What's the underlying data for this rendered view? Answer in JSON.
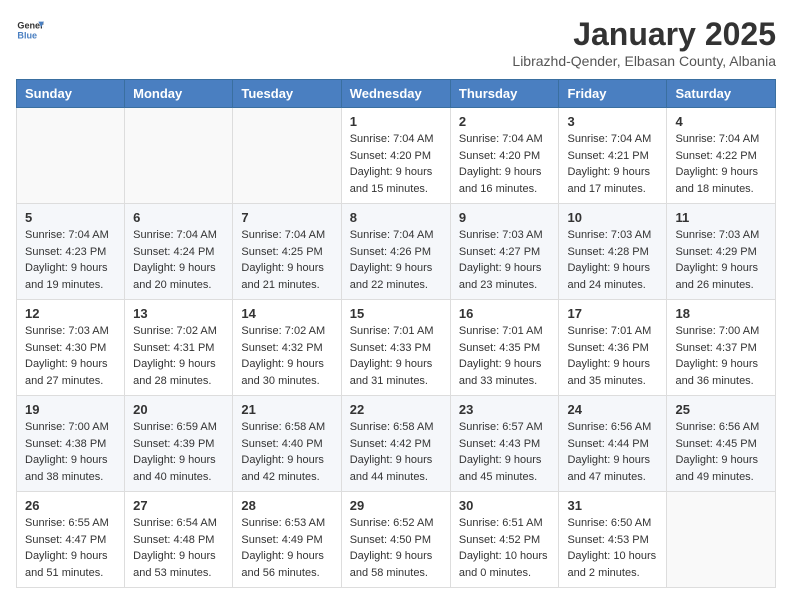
{
  "header": {
    "logo_general": "General",
    "logo_blue": "Blue",
    "month": "January 2025",
    "location": "Librazhd-Qender, Elbasan County, Albania"
  },
  "days_of_week": [
    "Sunday",
    "Monday",
    "Tuesday",
    "Wednesday",
    "Thursday",
    "Friday",
    "Saturday"
  ],
  "weeks": [
    [
      {
        "day": "",
        "sunrise": "",
        "sunset": "",
        "daylight": ""
      },
      {
        "day": "",
        "sunrise": "",
        "sunset": "",
        "daylight": ""
      },
      {
        "day": "",
        "sunrise": "",
        "sunset": "",
        "daylight": ""
      },
      {
        "day": "1",
        "sunrise": "Sunrise: 7:04 AM",
        "sunset": "Sunset: 4:20 PM",
        "daylight": "Daylight: 9 hours and 15 minutes."
      },
      {
        "day": "2",
        "sunrise": "Sunrise: 7:04 AM",
        "sunset": "Sunset: 4:20 PM",
        "daylight": "Daylight: 9 hours and 16 minutes."
      },
      {
        "day": "3",
        "sunrise": "Sunrise: 7:04 AM",
        "sunset": "Sunset: 4:21 PM",
        "daylight": "Daylight: 9 hours and 17 minutes."
      },
      {
        "day": "4",
        "sunrise": "Sunrise: 7:04 AM",
        "sunset": "Sunset: 4:22 PM",
        "daylight": "Daylight: 9 hours and 18 minutes."
      }
    ],
    [
      {
        "day": "5",
        "sunrise": "Sunrise: 7:04 AM",
        "sunset": "Sunset: 4:23 PM",
        "daylight": "Daylight: 9 hours and 19 minutes."
      },
      {
        "day": "6",
        "sunrise": "Sunrise: 7:04 AM",
        "sunset": "Sunset: 4:24 PM",
        "daylight": "Daylight: 9 hours and 20 minutes."
      },
      {
        "day": "7",
        "sunrise": "Sunrise: 7:04 AM",
        "sunset": "Sunset: 4:25 PM",
        "daylight": "Daylight: 9 hours and 21 minutes."
      },
      {
        "day": "8",
        "sunrise": "Sunrise: 7:04 AM",
        "sunset": "Sunset: 4:26 PM",
        "daylight": "Daylight: 9 hours and 22 minutes."
      },
      {
        "day": "9",
        "sunrise": "Sunrise: 7:03 AM",
        "sunset": "Sunset: 4:27 PM",
        "daylight": "Daylight: 9 hours and 23 minutes."
      },
      {
        "day": "10",
        "sunrise": "Sunrise: 7:03 AM",
        "sunset": "Sunset: 4:28 PM",
        "daylight": "Daylight: 9 hours and 24 minutes."
      },
      {
        "day": "11",
        "sunrise": "Sunrise: 7:03 AM",
        "sunset": "Sunset: 4:29 PM",
        "daylight": "Daylight: 9 hours and 26 minutes."
      }
    ],
    [
      {
        "day": "12",
        "sunrise": "Sunrise: 7:03 AM",
        "sunset": "Sunset: 4:30 PM",
        "daylight": "Daylight: 9 hours and 27 minutes."
      },
      {
        "day": "13",
        "sunrise": "Sunrise: 7:02 AM",
        "sunset": "Sunset: 4:31 PM",
        "daylight": "Daylight: 9 hours and 28 minutes."
      },
      {
        "day": "14",
        "sunrise": "Sunrise: 7:02 AM",
        "sunset": "Sunset: 4:32 PM",
        "daylight": "Daylight: 9 hours and 30 minutes."
      },
      {
        "day": "15",
        "sunrise": "Sunrise: 7:01 AM",
        "sunset": "Sunset: 4:33 PM",
        "daylight": "Daylight: 9 hours and 31 minutes."
      },
      {
        "day": "16",
        "sunrise": "Sunrise: 7:01 AM",
        "sunset": "Sunset: 4:35 PM",
        "daylight": "Daylight: 9 hours and 33 minutes."
      },
      {
        "day": "17",
        "sunrise": "Sunrise: 7:01 AM",
        "sunset": "Sunset: 4:36 PM",
        "daylight": "Daylight: 9 hours and 35 minutes."
      },
      {
        "day": "18",
        "sunrise": "Sunrise: 7:00 AM",
        "sunset": "Sunset: 4:37 PM",
        "daylight": "Daylight: 9 hours and 36 minutes."
      }
    ],
    [
      {
        "day": "19",
        "sunrise": "Sunrise: 7:00 AM",
        "sunset": "Sunset: 4:38 PM",
        "daylight": "Daylight: 9 hours and 38 minutes."
      },
      {
        "day": "20",
        "sunrise": "Sunrise: 6:59 AM",
        "sunset": "Sunset: 4:39 PM",
        "daylight": "Daylight: 9 hours and 40 minutes."
      },
      {
        "day": "21",
        "sunrise": "Sunrise: 6:58 AM",
        "sunset": "Sunset: 4:40 PM",
        "daylight": "Daylight: 9 hours and 42 minutes."
      },
      {
        "day": "22",
        "sunrise": "Sunrise: 6:58 AM",
        "sunset": "Sunset: 4:42 PM",
        "daylight": "Daylight: 9 hours and 44 minutes."
      },
      {
        "day": "23",
        "sunrise": "Sunrise: 6:57 AM",
        "sunset": "Sunset: 4:43 PM",
        "daylight": "Daylight: 9 hours and 45 minutes."
      },
      {
        "day": "24",
        "sunrise": "Sunrise: 6:56 AM",
        "sunset": "Sunset: 4:44 PM",
        "daylight": "Daylight: 9 hours and 47 minutes."
      },
      {
        "day": "25",
        "sunrise": "Sunrise: 6:56 AM",
        "sunset": "Sunset: 4:45 PM",
        "daylight": "Daylight: 9 hours and 49 minutes."
      }
    ],
    [
      {
        "day": "26",
        "sunrise": "Sunrise: 6:55 AM",
        "sunset": "Sunset: 4:47 PM",
        "daylight": "Daylight: 9 hours and 51 minutes."
      },
      {
        "day": "27",
        "sunrise": "Sunrise: 6:54 AM",
        "sunset": "Sunset: 4:48 PM",
        "daylight": "Daylight: 9 hours and 53 minutes."
      },
      {
        "day": "28",
        "sunrise": "Sunrise: 6:53 AM",
        "sunset": "Sunset: 4:49 PM",
        "daylight": "Daylight: 9 hours and 56 minutes."
      },
      {
        "day": "29",
        "sunrise": "Sunrise: 6:52 AM",
        "sunset": "Sunset: 4:50 PM",
        "daylight": "Daylight: 9 hours and 58 minutes."
      },
      {
        "day": "30",
        "sunrise": "Sunrise: 6:51 AM",
        "sunset": "Sunset: 4:52 PM",
        "daylight": "Daylight: 10 hours and 0 minutes."
      },
      {
        "day": "31",
        "sunrise": "Sunrise: 6:50 AM",
        "sunset": "Sunset: 4:53 PM",
        "daylight": "Daylight: 10 hours and 2 minutes."
      },
      {
        "day": "",
        "sunrise": "",
        "sunset": "",
        "daylight": ""
      }
    ]
  ]
}
